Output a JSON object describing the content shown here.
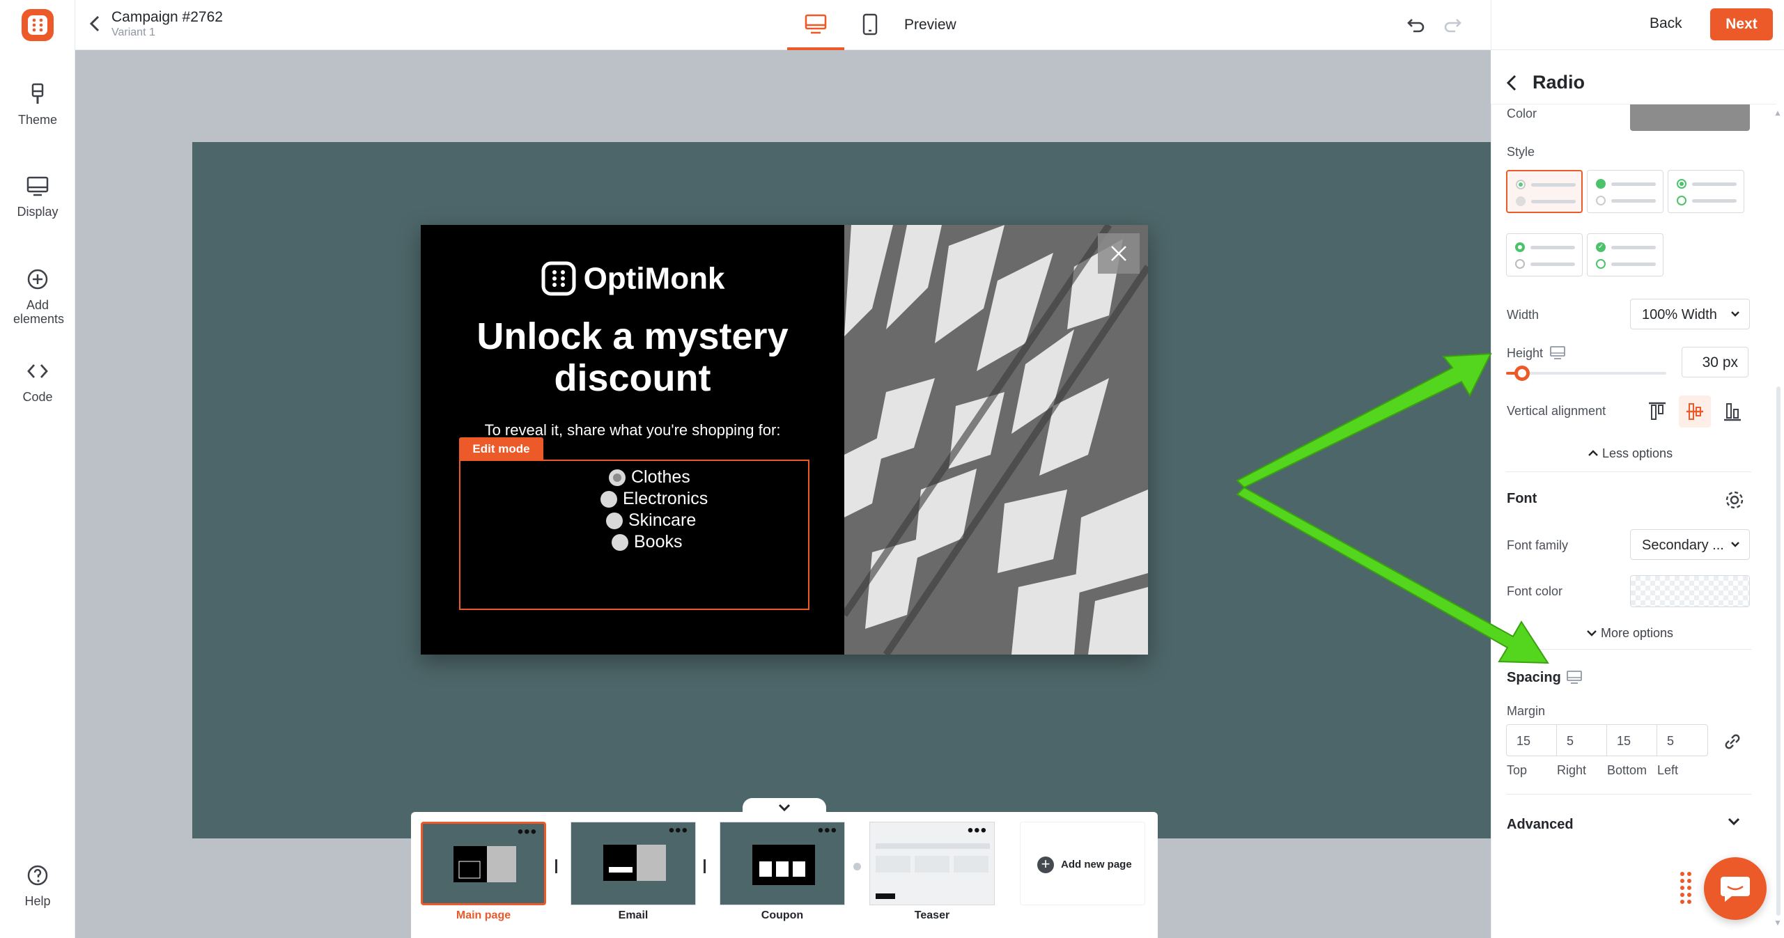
{
  "topbar": {
    "campaign_title": "Campaign #2762",
    "variant": "Variant 1",
    "preview_label": "Preview",
    "back_label": "Back",
    "next_label": "Next"
  },
  "rail": {
    "items": [
      {
        "label": "Theme",
        "icon": "brush-icon"
      },
      {
        "label": "Display",
        "icon": "monitor-icon"
      },
      {
        "label": "Add elements",
        "icon": "plus-circle-icon"
      },
      {
        "label": "Code",
        "icon": "code-icon"
      }
    ],
    "help_label": "Help"
  },
  "popup": {
    "brand": "OptiMonk",
    "headline": "Unlock a mystery discount",
    "subtext": "To reveal it, share what you're shopping for:",
    "edit_mode_label": "Edit mode",
    "options": [
      "Clothes",
      "Electronics",
      "Skincare",
      "Books"
    ],
    "selected_option": "Clothes"
  },
  "pages": {
    "items": [
      {
        "label": "Main page",
        "active": true
      },
      {
        "label": "Email",
        "active": false
      },
      {
        "label": "Coupon",
        "active": false
      },
      {
        "label": "Teaser",
        "active": false
      }
    ],
    "add_label": "Add new page"
  },
  "panel": {
    "title": "Radio",
    "color_label": "Color",
    "color_value": "#8c8c8c",
    "style_label": "Style",
    "width_label": "Width",
    "width_value": "100% Width",
    "height_label": "Height",
    "height_value": "30 px",
    "vertical_alignment_label": "Vertical alignment",
    "less_options_label": "Less options",
    "font_section": "Font",
    "font_family_label": "Font family",
    "font_family_value": "Secondary ...",
    "font_color_label": "Font color",
    "more_options_label": "More options",
    "spacing_section": "Spacing",
    "margin_label": "Margin",
    "margin": {
      "top": "15",
      "right": "5",
      "bottom": "15",
      "left": "5"
    },
    "margin_captions": {
      "top": "Top",
      "right": "Right",
      "bottom": "Bottom",
      "left": "Left"
    },
    "advanced_section": "Advanced"
  },
  "colors": {
    "accent": "#ed5a29",
    "canvas_bg": "#4d6669",
    "arrow": "#54d61e"
  }
}
